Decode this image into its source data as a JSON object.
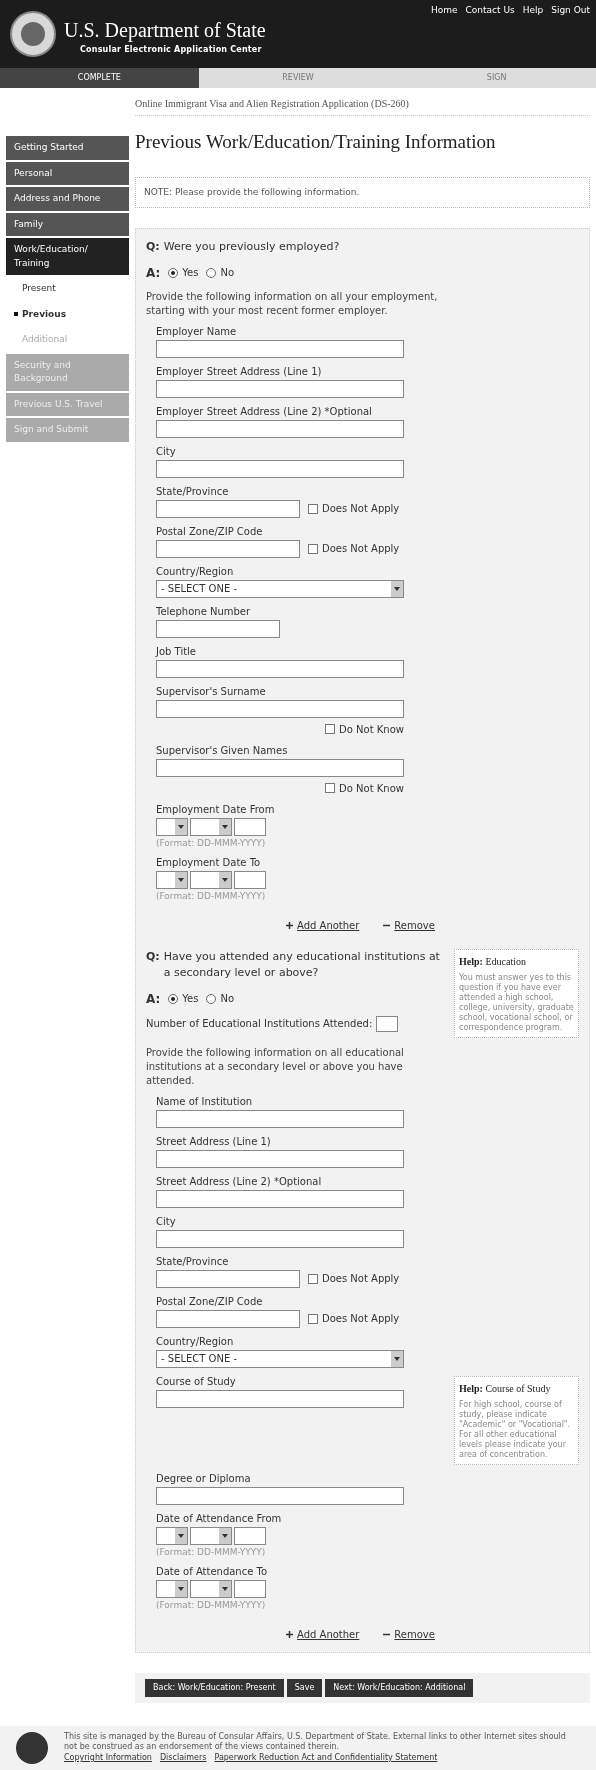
{
  "header": {
    "links": [
      "Home",
      "Contact Us",
      "Help",
      "Sign Out"
    ],
    "title": "U.S. Department of State",
    "subtitle": "Consular Electronic Application Center"
  },
  "progress": [
    {
      "label": "COMPLETE",
      "selected": true
    },
    {
      "label": "REVIEW",
      "selected": false
    },
    {
      "label": "SIGN",
      "selected": false
    }
  ],
  "form_name": "Online Immigrant Visa and Alien Registration Application (DS-260)",
  "nav": [
    {
      "label": "Getting Started",
      "disabled": false,
      "selected": false
    },
    {
      "label": "Personal",
      "disabled": false,
      "selected": false
    },
    {
      "label": "Address and Phone",
      "disabled": false,
      "selected": false
    },
    {
      "label": "Family",
      "disabled": false,
      "selected": false
    },
    {
      "label": "Work/Education/ Training",
      "selected": true,
      "children": [
        {
          "label": "Present",
          "selected": false,
          "disabled": false
        },
        {
          "label": "Previous",
          "selected": true,
          "disabled": false
        },
        {
          "label": "Additional",
          "selected": false,
          "disabled": true
        }
      ]
    },
    {
      "label": "Security and Background",
      "disabled": true,
      "selected": false
    },
    {
      "label": "Previous U.S. Travel",
      "disabled": true,
      "selected": false
    },
    {
      "label": "Sign and Submit",
      "disabled": true,
      "selected": false
    }
  ],
  "page_title": "Previous Work/Education/Training Information",
  "note": "NOTE: Please provide the following information.",
  "sections": [
    {
      "q_marker": "Q:",
      "a_marker": "A:",
      "question": "Were you previously employed?",
      "answers": [
        {
          "label": "Yes",
          "selected": true
        },
        {
          "label": "No",
          "selected": false
        }
      ],
      "instructions": "Provide the following information on all your employment, starting with your most recent former employer.",
      "fields": [
        {
          "kind": "text",
          "label": "Employer Name"
        },
        {
          "kind": "text",
          "label": "Employer Street Address (Line 1)"
        },
        {
          "kind": "text",
          "label": "Employer Street Address (Line 2) *Optional"
        },
        {
          "kind": "text",
          "label": "City"
        },
        {
          "kind": "inline-check",
          "label": "State/Province",
          "check": {
            "label": "Does Not Apply",
            "checked": false
          }
        },
        {
          "kind": "inline-check",
          "label": "Postal Zone/ZIP Code",
          "check": {
            "label": "Does Not Apply",
            "checked": false
          }
        },
        {
          "kind": "select",
          "label": "Country/Region",
          "value": "- SELECT ONE -"
        },
        {
          "kind": "short",
          "label": "Telephone Number"
        },
        {
          "kind": "text",
          "label": "Job Title"
        },
        {
          "kind": "below-check",
          "label": "Supervisor's Surname",
          "check": {
            "label": "Do Not Know",
            "checked": false
          }
        },
        {
          "kind": "below-check",
          "label": "Supervisor's Given Names",
          "check": {
            "label": "Do Not Know",
            "checked": false
          }
        },
        {
          "kind": "date",
          "label": "Employment Date From",
          "hint": "(Format: DD-MMM-YYYY)"
        },
        {
          "kind": "date",
          "label": "Employment Date To",
          "hint": "(Format: DD-MMM-YYYY)"
        }
      ],
      "actions": [
        "Add Another",
        "Remove"
      ]
    },
    {
      "q_marker": "Q:",
      "a_marker": "A:",
      "question": "Have you attended any educational institutions at a secondary level or above?",
      "answers": [
        {
          "label": "Yes",
          "selected": true
        },
        {
          "label": "No",
          "selected": false
        }
      ],
      "help": {
        "title": "Help:",
        "topic": "Education",
        "text": "You must answer yes to this question if you have ever attended a high school, college, university, graduate school, vocational school, or correspondence program."
      },
      "count_label": "Number of Educational Institutions Attended:",
      "instructions": "Provide the following information on all educational institutions at a secondary level or above you have attended.",
      "fields": [
        {
          "kind": "text",
          "label": "Name of Institution"
        },
        {
          "kind": "text",
          "label": "Street Address (Line 1)"
        },
        {
          "kind": "text",
          "label": "Street Address (Line 2) *Optional"
        },
        {
          "kind": "text",
          "label": "City"
        },
        {
          "kind": "inline-check",
          "label": "State/Province",
          "check": {
            "label": "Does Not Apply",
            "checked": false
          }
        },
        {
          "kind": "inline-check",
          "label": "Postal Zone/ZIP Code",
          "check": {
            "label": "Does Not Apply",
            "checked": false
          }
        },
        {
          "kind": "select",
          "label": "Country/Region",
          "value": "- SELECT ONE -"
        },
        {
          "kind": "text",
          "label": "Course of Study",
          "help": {
            "title": "Help:",
            "topic": "Course of Study",
            "text": "For high school, course of study, please indicate \"Academic\" or \"Vocational\". For all other educational levels please indicate your area of concentration."
          }
        },
        {
          "kind": "text",
          "label": "Degree or Diploma"
        },
        {
          "kind": "date",
          "label": "Date of Attendance From",
          "hint": "(Format: DD-MMM-YYYY)"
        },
        {
          "kind": "date",
          "label": "Date of Attendance To",
          "hint": "(Format: DD-MMM-YYYY)"
        }
      ],
      "actions": [
        "Add Another",
        "Remove"
      ]
    }
  ],
  "buttons": [
    "Back: Work/Education: Present",
    "Save",
    "Next: Work/Education: Additional"
  ],
  "footer": {
    "text": "This site is managed by the Bureau of Consular Affairs, U.S. Department of State. External links to other Internet sites should not be construed as an endorsement of the views contained therein.",
    "links": [
      "Copyright Information",
      "Disclaimers",
      "Paperwork Reduction Act and Confidentiality Statement"
    ]
  }
}
